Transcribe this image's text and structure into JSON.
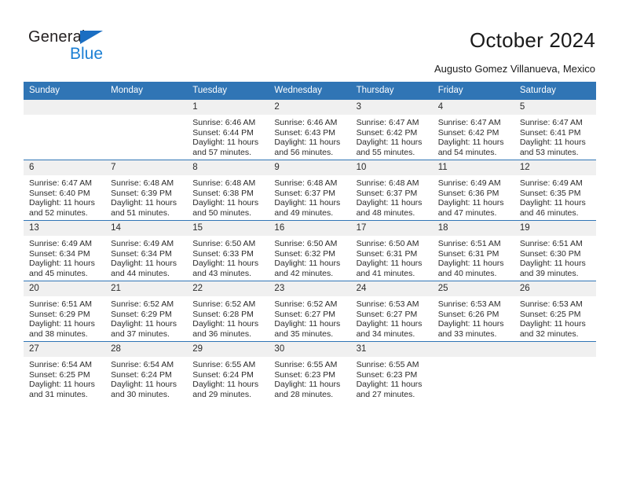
{
  "brand": {
    "name_part1": "General",
    "name_part2": "Blue",
    "triangle_icon": "triangle-icon",
    "accent_color": "#1b6ec2"
  },
  "header": {
    "title": "October 2024",
    "subtitle": "Augusto Gomez Villanueva, Mexico"
  },
  "calendar": {
    "header_color": "#3075b5",
    "weekday_headers": [
      "Sunday",
      "Monday",
      "Tuesday",
      "Wednesday",
      "Thursday",
      "Friday",
      "Saturday"
    ],
    "labels": {
      "sunrise": "Sunrise:",
      "sunset": "Sunset:",
      "daylight": "Daylight:"
    },
    "weeks": [
      [
        {
          "day": "",
          "blank": true
        },
        {
          "day": "",
          "blank": true
        },
        {
          "day": "1",
          "sunrise": "Sunrise: 6:46 AM",
          "sunset": "Sunset: 6:44 PM",
          "daylight": "Daylight: 11 hours and 57 minutes."
        },
        {
          "day": "2",
          "sunrise": "Sunrise: 6:46 AM",
          "sunset": "Sunset: 6:43 PM",
          "daylight": "Daylight: 11 hours and 56 minutes."
        },
        {
          "day": "3",
          "sunrise": "Sunrise: 6:47 AM",
          "sunset": "Sunset: 6:42 PM",
          "daylight": "Daylight: 11 hours and 55 minutes."
        },
        {
          "day": "4",
          "sunrise": "Sunrise: 6:47 AM",
          "sunset": "Sunset: 6:42 PM",
          "daylight": "Daylight: 11 hours and 54 minutes."
        },
        {
          "day": "5",
          "sunrise": "Sunrise: 6:47 AM",
          "sunset": "Sunset: 6:41 PM",
          "daylight": "Daylight: 11 hours and 53 minutes."
        }
      ],
      [
        {
          "day": "6",
          "sunrise": "Sunrise: 6:47 AM",
          "sunset": "Sunset: 6:40 PM",
          "daylight": "Daylight: 11 hours and 52 minutes."
        },
        {
          "day": "7",
          "sunrise": "Sunrise: 6:48 AM",
          "sunset": "Sunset: 6:39 PM",
          "daylight": "Daylight: 11 hours and 51 minutes."
        },
        {
          "day": "8",
          "sunrise": "Sunrise: 6:48 AM",
          "sunset": "Sunset: 6:38 PM",
          "daylight": "Daylight: 11 hours and 50 minutes."
        },
        {
          "day": "9",
          "sunrise": "Sunrise: 6:48 AM",
          "sunset": "Sunset: 6:37 PM",
          "daylight": "Daylight: 11 hours and 49 minutes."
        },
        {
          "day": "10",
          "sunrise": "Sunrise: 6:48 AM",
          "sunset": "Sunset: 6:37 PM",
          "daylight": "Daylight: 11 hours and 48 minutes."
        },
        {
          "day": "11",
          "sunrise": "Sunrise: 6:49 AM",
          "sunset": "Sunset: 6:36 PM",
          "daylight": "Daylight: 11 hours and 47 minutes."
        },
        {
          "day": "12",
          "sunrise": "Sunrise: 6:49 AM",
          "sunset": "Sunset: 6:35 PM",
          "daylight": "Daylight: 11 hours and 46 minutes."
        }
      ],
      [
        {
          "day": "13",
          "sunrise": "Sunrise: 6:49 AM",
          "sunset": "Sunset: 6:34 PM",
          "daylight": "Daylight: 11 hours and 45 minutes."
        },
        {
          "day": "14",
          "sunrise": "Sunrise: 6:49 AM",
          "sunset": "Sunset: 6:34 PM",
          "daylight": "Daylight: 11 hours and 44 minutes."
        },
        {
          "day": "15",
          "sunrise": "Sunrise: 6:50 AM",
          "sunset": "Sunset: 6:33 PM",
          "daylight": "Daylight: 11 hours and 43 minutes."
        },
        {
          "day": "16",
          "sunrise": "Sunrise: 6:50 AM",
          "sunset": "Sunset: 6:32 PM",
          "daylight": "Daylight: 11 hours and 42 minutes."
        },
        {
          "day": "17",
          "sunrise": "Sunrise: 6:50 AM",
          "sunset": "Sunset: 6:31 PM",
          "daylight": "Daylight: 11 hours and 41 minutes."
        },
        {
          "day": "18",
          "sunrise": "Sunrise: 6:51 AM",
          "sunset": "Sunset: 6:31 PM",
          "daylight": "Daylight: 11 hours and 40 minutes."
        },
        {
          "day": "19",
          "sunrise": "Sunrise: 6:51 AM",
          "sunset": "Sunset: 6:30 PM",
          "daylight": "Daylight: 11 hours and 39 minutes."
        }
      ],
      [
        {
          "day": "20",
          "sunrise": "Sunrise: 6:51 AM",
          "sunset": "Sunset: 6:29 PM",
          "daylight": "Daylight: 11 hours and 38 minutes."
        },
        {
          "day": "21",
          "sunrise": "Sunrise: 6:52 AM",
          "sunset": "Sunset: 6:29 PM",
          "daylight": "Daylight: 11 hours and 37 minutes."
        },
        {
          "day": "22",
          "sunrise": "Sunrise: 6:52 AM",
          "sunset": "Sunset: 6:28 PM",
          "daylight": "Daylight: 11 hours and 36 minutes."
        },
        {
          "day": "23",
          "sunrise": "Sunrise: 6:52 AM",
          "sunset": "Sunset: 6:27 PM",
          "daylight": "Daylight: 11 hours and 35 minutes."
        },
        {
          "day": "24",
          "sunrise": "Sunrise: 6:53 AM",
          "sunset": "Sunset: 6:27 PM",
          "daylight": "Daylight: 11 hours and 34 minutes."
        },
        {
          "day": "25",
          "sunrise": "Sunrise: 6:53 AM",
          "sunset": "Sunset: 6:26 PM",
          "daylight": "Daylight: 11 hours and 33 minutes."
        },
        {
          "day": "26",
          "sunrise": "Sunrise: 6:53 AM",
          "sunset": "Sunset: 6:25 PM",
          "daylight": "Daylight: 11 hours and 32 minutes."
        }
      ],
      [
        {
          "day": "27",
          "sunrise": "Sunrise: 6:54 AM",
          "sunset": "Sunset: 6:25 PM",
          "daylight": "Daylight: 11 hours and 31 minutes."
        },
        {
          "day": "28",
          "sunrise": "Sunrise: 6:54 AM",
          "sunset": "Sunset: 6:24 PM",
          "daylight": "Daylight: 11 hours and 30 minutes."
        },
        {
          "day": "29",
          "sunrise": "Sunrise: 6:55 AM",
          "sunset": "Sunset: 6:24 PM",
          "daylight": "Daylight: 11 hours and 29 minutes."
        },
        {
          "day": "30",
          "sunrise": "Sunrise: 6:55 AM",
          "sunset": "Sunset: 6:23 PM",
          "daylight": "Daylight: 11 hours and 28 minutes."
        },
        {
          "day": "31",
          "sunrise": "Sunrise: 6:55 AM",
          "sunset": "Sunset: 6:23 PM",
          "daylight": "Daylight: 11 hours and 27 minutes."
        },
        {
          "day": "",
          "blank": true
        },
        {
          "day": "",
          "blank": true
        }
      ]
    ]
  }
}
